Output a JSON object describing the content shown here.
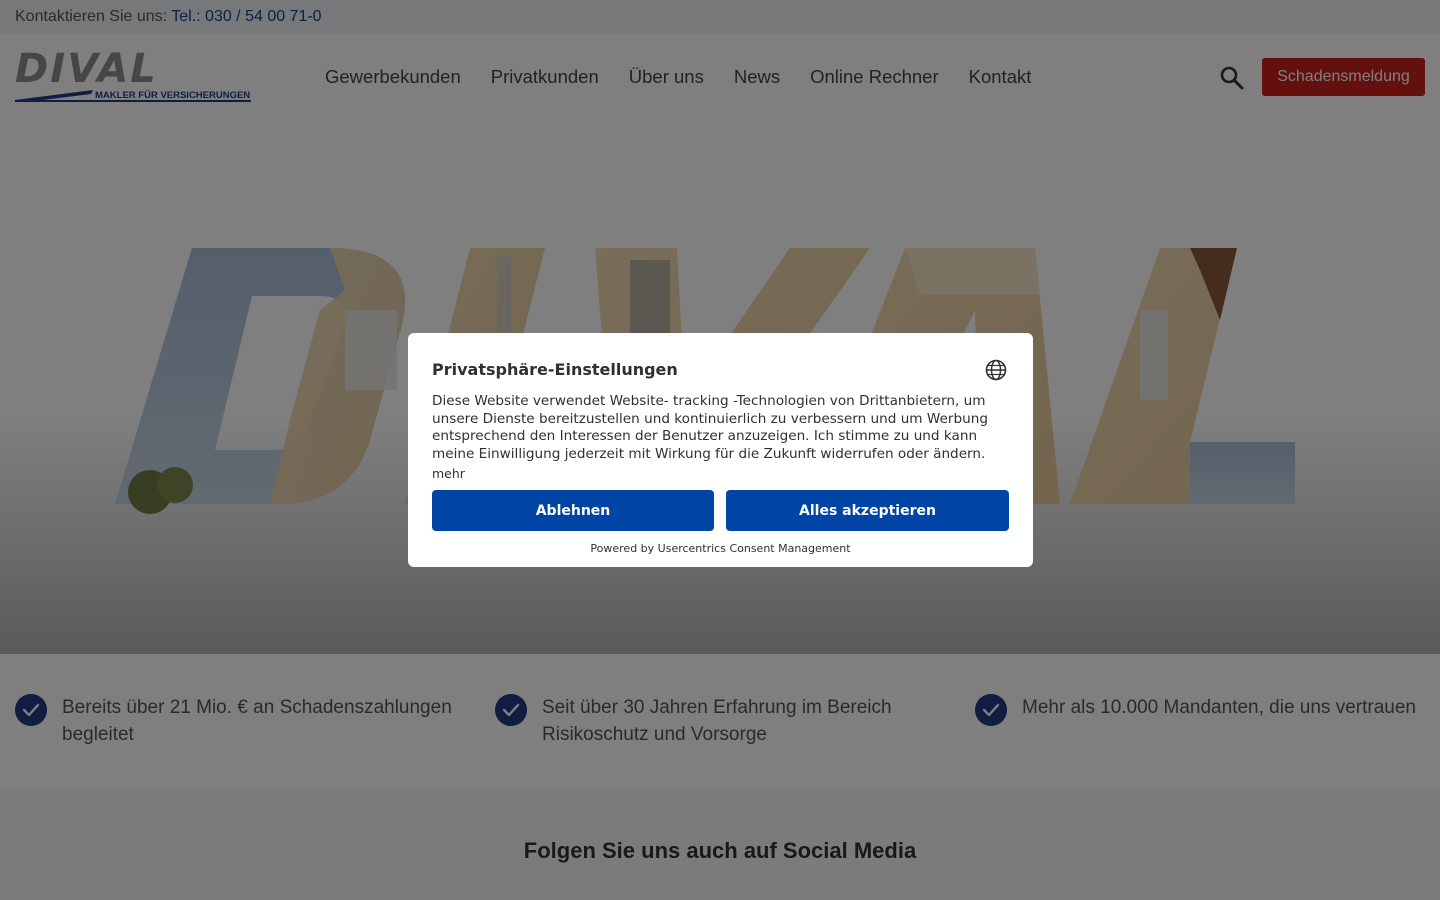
{
  "topbar": {
    "prefix": "Kontaktieren Sie uns: ",
    "phone": "Tel.: 030 / 54 00 71-0"
  },
  "logo": {
    "word": "DIVAL",
    "tagline": "MAKLER FÜR VERSICHERUNGEN"
  },
  "nav": [
    "Gewerbekunden",
    "Privatkunden",
    "Über uns",
    "News",
    "Online Rechner",
    "Kontakt"
  ],
  "header": {
    "search_icon": "search-icon",
    "cta_label": "Schadensmeldung"
  },
  "hero": {
    "graphic": "DIVAL lettering with building photo fill"
  },
  "features": [
    "Bereits über 21 Mio. € an Schadenszahlungen begleitet",
    "Seit über 30 Jahren Erfahrung im Bereich Risikoschutz und Vorsorge",
    "Mehr als 10.000 Mandanten, die uns vertrauen"
  ],
  "social": {
    "title": "Folgen Sie uns auch auf Social Media"
  },
  "consent": {
    "title": "Privatsphäre-Einstellungen",
    "body": "Diese Website verwendet Website- tracking -Technologien von Drittanbietern, um unsere Dienste bereitzustellen und kontinuierlich zu verbessern und um Werbung entsprechend den Interessen der Benutzer anzuzeigen. Ich stimme zu und kann meine Einwilligung jederzeit mit Wirkung für die Zukunft widerrufen oder ändern.",
    "more": "mehr",
    "deny": "Ablehnen",
    "accept": "Alles akzeptieren",
    "powered_by": "Powered by Usercentrics Consent Management",
    "language_icon": "globe-icon"
  },
  "colors": {
    "brand_blue": "#223a84",
    "cta_red": "#c6211f",
    "consent_blue": "#0045a5"
  }
}
